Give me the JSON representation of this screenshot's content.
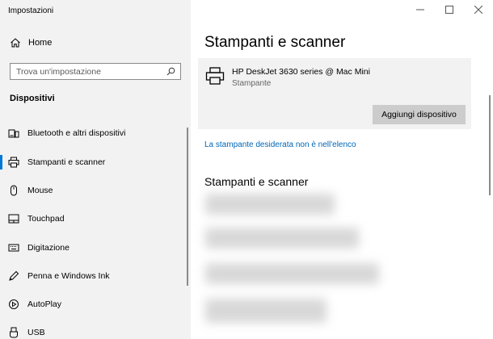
{
  "window": {
    "title": "Impostazioni"
  },
  "sidebar": {
    "home_label": "Home",
    "search_placeholder": "Trova un'impostazione",
    "section_title": "Dispositivi",
    "items": [
      {
        "label": "Bluetooth e altri dispositivi",
        "icon": "bluetooth-devices-icon"
      },
      {
        "label": "Stampanti e scanner",
        "icon": "printer-icon",
        "selected": true
      },
      {
        "label": "Mouse",
        "icon": "mouse-icon"
      },
      {
        "label": "Touchpad",
        "icon": "touchpad-icon"
      },
      {
        "label": "Digitazione",
        "icon": "keyboard-icon"
      },
      {
        "label": "Penna e Windows Ink",
        "icon": "pen-icon"
      },
      {
        "label": "AutoPlay",
        "icon": "autoplay-icon"
      },
      {
        "label": "USB",
        "icon": "usb-icon"
      }
    ]
  },
  "main": {
    "title": "Stampanti e scanner",
    "printer": {
      "name": "HP DeskJet 3630 series @ Mac Mini",
      "status": "Stampante",
      "add_button_label": "Aggiungi dispositivo"
    },
    "link_text": "La stampante desiderata non è nell'elenco",
    "section_title": "Stampanti e scanner"
  },
  "colors": {
    "sidebar_bg": "#f2f2f2",
    "accent": "#0078d7",
    "link": "#0067b8",
    "button_bg": "#cccccc"
  }
}
